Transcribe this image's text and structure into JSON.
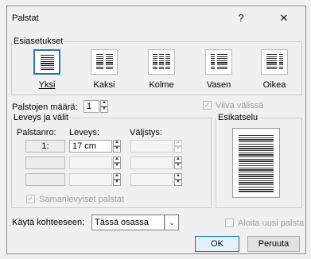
{
  "dialog": {
    "title": "Palstat",
    "help_label": "?",
    "close_label": "✕"
  },
  "presets": {
    "group_label": "Esiasetukset",
    "items": [
      {
        "label": "Yksi",
        "selected": true
      },
      {
        "label": "Kaksi",
        "selected": false
      },
      {
        "label": "Kolme",
        "selected": false
      },
      {
        "label": "Vasen",
        "selected": false
      },
      {
        "label": "Oikea",
        "selected": false
      }
    ]
  },
  "column_count": {
    "label": "Palstojen määrä:",
    "value": "1"
  },
  "line_between": {
    "label": "Viiva välissä",
    "checked": true,
    "enabled": false
  },
  "widths": {
    "group_label": "Leveys ja välit",
    "col_header": "Palstanro:",
    "width_header": "Leveys:",
    "spacing_header": "Väljstys:",
    "rows": [
      {
        "num": "1:",
        "width": "17 cm",
        "spacing": ""
      },
      {
        "num": "",
        "width": "",
        "spacing": ""
      },
      {
        "num": "",
        "width": "",
        "spacing": ""
      }
    ],
    "equal_label": "Samanlevyiset palstat",
    "equal_checked": true
  },
  "preview": {
    "group_label": "Esikatselu"
  },
  "apply_to": {
    "label": "Käytä kohteeseen:",
    "value": "Tässä osassa"
  },
  "new_column": {
    "label": "Aloita uusi palsta",
    "checked": false
  },
  "buttons": {
    "ok": "OK",
    "cancel": "Peruuta"
  }
}
